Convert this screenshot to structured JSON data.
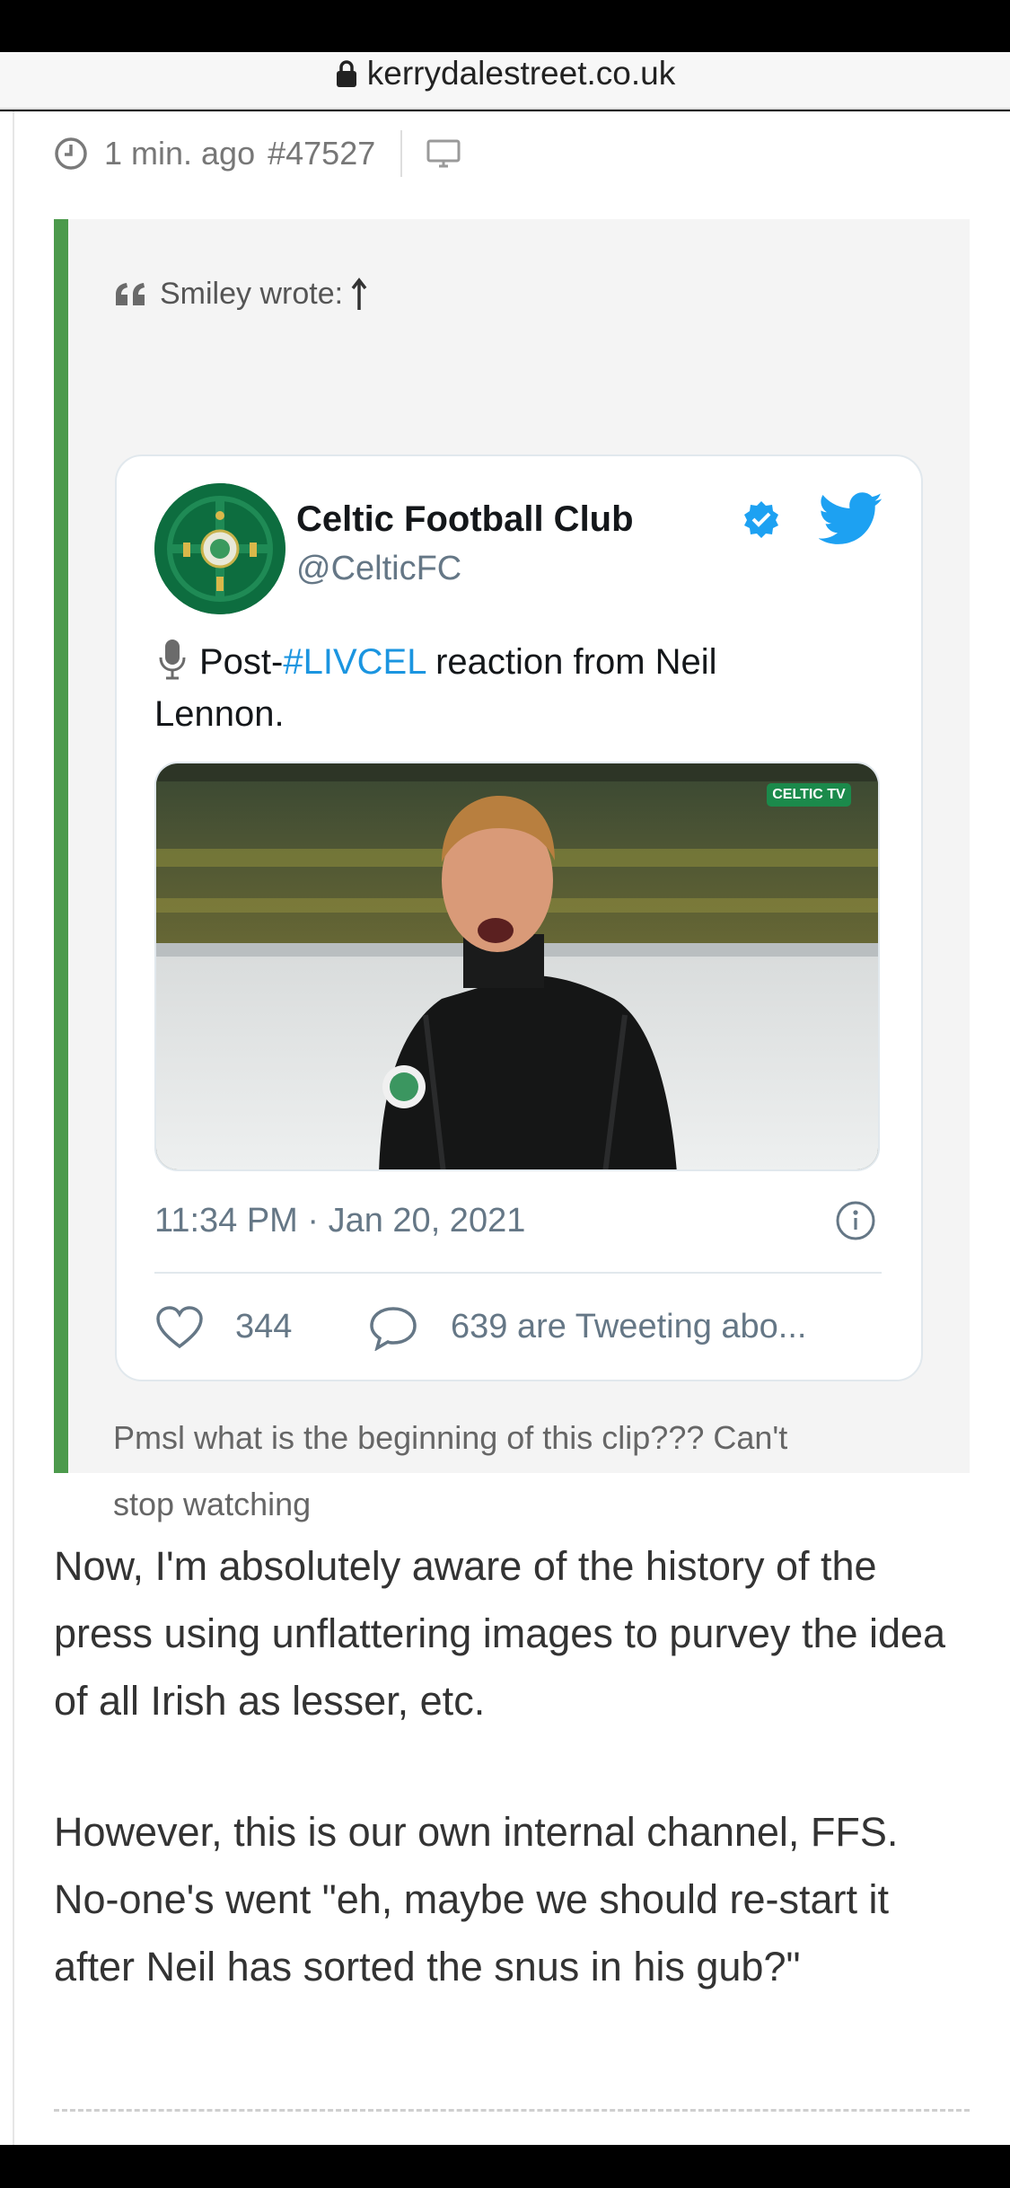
{
  "browser": {
    "url": "kerrydalestreet.co.uk"
  },
  "post_meta": {
    "time_ago": "1 min. ago",
    "post_number": "#47527"
  },
  "quote": {
    "header": "Smiley wrote:",
    "tweet": {
      "author_name": "Celtic Football Club",
      "author_handle": "@CelticFC",
      "text_prefix": "Post-",
      "hashtag": "#LIVCEL",
      "text_line1_rest": " reaction from Neil",
      "text_line2": "Lennon.",
      "media_badge": "CELTIC TV",
      "timestamp": "11:34 PM · Jan 20, 2021",
      "likes": "344",
      "talking": "639 are Tweeting abo..."
    },
    "quoted_text_line1": "Pmsl what is the beginning of this clip??? Can't",
    "quoted_text_line2": "stop watching"
  },
  "body": {
    "paragraphs": [
      "Now, I'm absolutely aware of the history of the press using unflattering images to purvey the idea of all Irish as lesser, etc.",
      "However, this is our own internal channel, FFS. No-one's went \"eh, maybe we should re-start it after Neil has sorted the snus in his gub?\""
    ]
  },
  "colors": {
    "quote_bar": "#4c9a4c",
    "hashtag": "#1b95e0",
    "twitter_blue": "#1da1f2",
    "celtic_green": "#0d6d3f"
  },
  "icons": [
    "lock-icon",
    "clock-icon",
    "monitor-icon",
    "quote-mark-icon",
    "arrow-up-icon",
    "verified-icon",
    "twitter-bird-icon",
    "microphone-icon",
    "info-icon",
    "heart-icon",
    "reply-icon"
  ]
}
